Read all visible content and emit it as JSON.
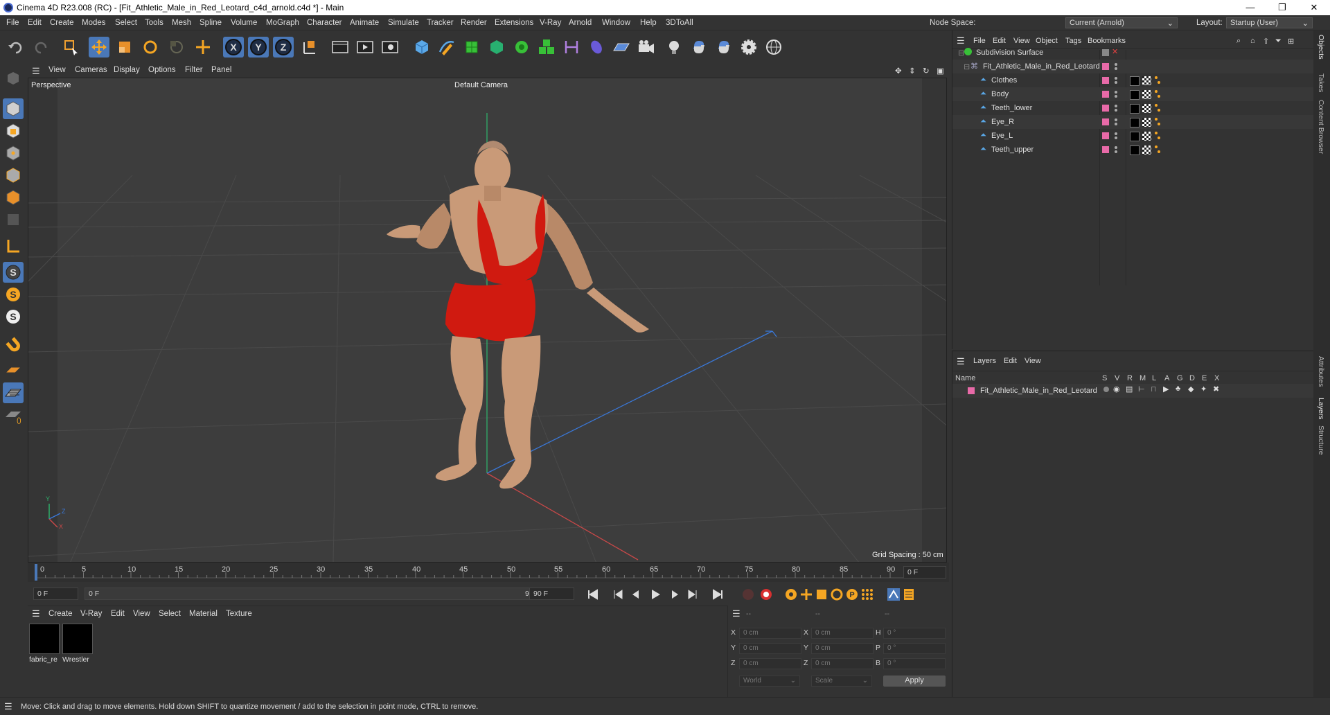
{
  "window": {
    "title": "Cinema 4D R23.008 (RC) - [Fit_Athletic_Male_in_Red_Leotard_c4d_arnold.c4d *] - Main"
  },
  "menubar": {
    "items": [
      "File",
      "Edit",
      "Create",
      "Modes",
      "Select",
      "Tools",
      "Mesh",
      "Spline",
      "Volume",
      "MoGraph",
      "Character",
      "Animate",
      "Simulate",
      "Tracker",
      "Render",
      "Extensions",
      "V-Ray",
      "Arnold",
      "Window",
      "Help",
      "3DToAll"
    ],
    "node_space_label": "Node Space:",
    "node_space_value": "Current (Arnold)",
    "layout_label": "Layout:",
    "layout_value": "Startup (User)"
  },
  "viewport": {
    "menu": [
      "View",
      "Cameras",
      "Display",
      "Options",
      "Filter",
      "Panel"
    ],
    "label": "Perspective",
    "camera": "Default Camera",
    "grid_spacing": "Grid Spacing : 50 cm",
    "axis_y": "Y",
    "axis_z": "Z",
    "axis_x": "X"
  },
  "timeline": {
    "ticks": [
      "0",
      "5",
      "10",
      "15",
      "20",
      "25",
      "30",
      "35",
      "40",
      "45",
      "50",
      "55",
      "60",
      "65",
      "70",
      "75",
      "80",
      "85",
      "90"
    ],
    "current_frame": "0 F"
  },
  "transport": {
    "start": "0 F",
    "range_start": "0 F",
    "range_end": "90 F",
    "end": "90 F"
  },
  "material_manager": {
    "menu": [
      "Create",
      "V-Ray",
      "Edit",
      "View",
      "Select",
      "Material",
      "Texture"
    ],
    "materials": [
      {
        "name": "fabric_re"
      },
      {
        "name": "Wrestler"
      }
    ]
  },
  "coordinates": {
    "header": [
      "--",
      "--",
      "--"
    ],
    "rows": [
      {
        "a_label": "X",
        "a_val": "0 cm",
        "b_label": "X",
        "b_val": "0 cm",
        "c_label": "H",
        "c_val": "0 °"
      },
      {
        "a_label": "Y",
        "a_val": "0 cm",
        "b_label": "Y",
        "b_val": "0 cm",
        "c_label": "P",
        "c_val": "0 °"
      },
      {
        "a_label": "Z",
        "a_val": "0 cm",
        "b_label": "Z",
        "b_val": "0 cm",
        "c_label": "B",
        "c_val": "0 °"
      }
    ],
    "space": "World",
    "mode": "Scale",
    "apply": "Apply"
  },
  "object_manager": {
    "menu": [
      "File",
      "Edit",
      "View",
      "Object",
      "Tags",
      "Bookmarks"
    ],
    "objects": [
      {
        "name": "Subdivision Surface",
        "level": 0
      },
      {
        "name": "Fit_Athletic_Male_in_Red_Leotard",
        "level": 1
      },
      {
        "name": "Clothes",
        "level": 2
      },
      {
        "name": "Body",
        "level": 2
      },
      {
        "name": "Teeth_lower",
        "level": 2
      },
      {
        "name": "Eye_R",
        "level": 2
      },
      {
        "name": "Eye_L",
        "level": 2
      },
      {
        "name": "Teeth_upper",
        "level": 2
      }
    ]
  },
  "layer_manager": {
    "menu": [
      "Layers",
      "Edit",
      "View"
    ],
    "columns": [
      "Name",
      "S",
      "V",
      "R",
      "M",
      "L",
      "A",
      "G",
      "D",
      "E",
      "X"
    ],
    "layers": [
      {
        "name": "Fit_Athletic_Male_in_Red_Leotard",
        "color": "#e86aa8"
      }
    ]
  },
  "right_tabs": [
    "Objects",
    "Takes",
    "Content Browser",
    "Attributes",
    "Layers",
    "Structure"
  ],
  "status": {
    "text": "Move: Click and drag to move elements. Hold down SHIFT to quantize movement / add to the selection in point mode, CTRL to remove."
  },
  "colors": {
    "accent": "#4a78b8",
    "layer_pink": "#e86aa8",
    "leotard_red": "#d01a10",
    "skin": "#c99a78"
  }
}
